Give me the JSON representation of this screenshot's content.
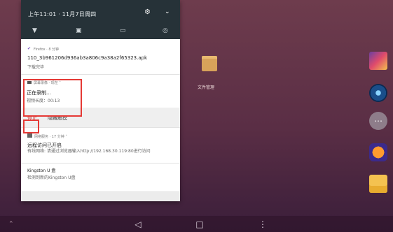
{
  "status": {
    "time_date": "上午11:01 · 11月7日周四"
  },
  "quick_settings": {
    "icons": [
      "wifi-icon",
      "rotate-icon",
      "cast-icon",
      "hotspot-icon"
    ]
  },
  "notifications": {
    "download": {
      "app": "Firefox",
      "time": "8 分钟",
      "filename": "110_3b961206d936ab3a806c9a38a2f65323.apk",
      "status": "下载完毕"
    },
    "screen_record": {
      "app": "屏幕录像",
      "time": "现在",
      "title": "正在录制…",
      "duration_text": "视频长度：00:13",
      "actions": [
        "停止",
        "隐藏触摸"
      ]
    },
    "network_service": {
      "app": "网络服务",
      "time": "17 分钟",
      "title": "远程访问已开启",
      "body": "有线网络: 请通过浏览器输入http://192.168.30.119:80进行访问"
    },
    "storage": {
      "title": "Kingston U 盘",
      "body": "检测到新的Kingston U盘"
    }
  },
  "desktop": {
    "folder_label": "文件管理"
  }
}
